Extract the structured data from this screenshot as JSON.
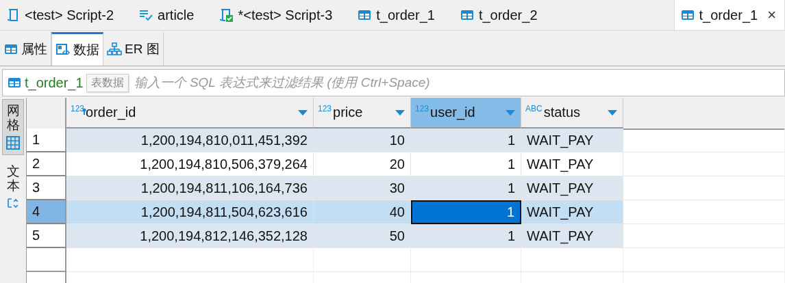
{
  "editor_tabs": [
    {
      "label": "<test> Script-2",
      "kind": "script",
      "selected": false
    },
    {
      "label": "article",
      "kind": "checked-list",
      "selected": false
    },
    {
      "label": "*<test> Script-3",
      "kind": "script-saved",
      "selected": false
    },
    {
      "label": "t_order_1",
      "kind": "table",
      "selected": false
    },
    {
      "label": "t_order_2",
      "kind": "table",
      "selected": false
    },
    {
      "label": "t_order_1",
      "kind": "table",
      "selected": true,
      "close": "×"
    }
  ],
  "view_tabs": [
    {
      "label": "属性",
      "kind": "table",
      "selected": false
    },
    {
      "label": "数据",
      "kind": "data",
      "selected": true
    },
    {
      "label": "ER 图",
      "kind": "diagram",
      "selected": false
    }
  ],
  "filter": {
    "label": "t_order_1",
    "tooltip": "表数据",
    "placeholder": "输入一个 SQL 表达式来过滤结果 (使用 Ctrl+Space)"
  },
  "side_tabs": [
    {
      "label": "网格",
      "kind": "grid",
      "selected": true
    },
    {
      "label": "文本",
      "kind": "text",
      "selected": false
    }
  ],
  "table": {
    "columns": [
      {
        "name": "order_id",
        "type_label": "123",
        "kind": "number",
        "primary_key": true,
        "selected": false
      },
      {
        "name": "price",
        "type_label": "123",
        "kind": "number",
        "primary_key": false,
        "selected": false
      },
      {
        "name": "user_id",
        "type_label": "123",
        "kind": "number",
        "primary_key": false,
        "selected": true
      },
      {
        "name": "status",
        "type_label": "ABC",
        "kind": "text",
        "primary_key": false,
        "selected": false
      }
    ],
    "rows": [
      {
        "number": "1",
        "selected": false,
        "cells": [
          {
            "text": "1,200,194,810,011,451,392",
            "focused": false
          },
          {
            "text": "10",
            "focused": false
          },
          {
            "text": "1",
            "focused": false
          },
          {
            "text": "WAIT_PAY",
            "focused": false
          }
        ]
      },
      {
        "number": "2",
        "selected": false,
        "cells": [
          {
            "text": "1,200,194,810,506,379,264",
            "focused": false
          },
          {
            "text": "20",
            "focused": false
          },
          {
            "text": "1",
            "focused": false
          },
          {
            "text": "WAIT_PAY",
            "focused": false
          }
        ]
      },
      {
        "number": "3",
        "selected": false,
        "cells": [
          {
            "text": "1,200,194,811,106,164,736",
            "focused": false
          },
          {
            "text": "30",
            "focused": false
          },
          {
            "text": "1",
            "focused": false
          },
          {
            "text": "WAIT_PAY",
            "focused": false
          }
        ]
      },
      {
        "number": "4",
        "selected": true,
        "cells": [
          {
            "text": "1,200,194,811,504,623,616",
            "focused": false
          },
          {
            "text": "40",
            "focused": false
          },
          {
            "text": "1",
            "focused": true
          },
          {
            "text": "WAIT_PAY",
            "focused": false
          }
        ]
      },
      {
        "number": "5",
        "selected": false,
        "cells": [
          {
            "text": "1,200,194,812,146,352,128",
            "focused": false
          },
          {
            "text": "50",
            "focused": false
          },
          {
            "text": "1",
            "focused": false
          },
          {
            "text": "WAIT_PAY",
            "focused": false
          }
        ]
      }
    ]
  }
}
